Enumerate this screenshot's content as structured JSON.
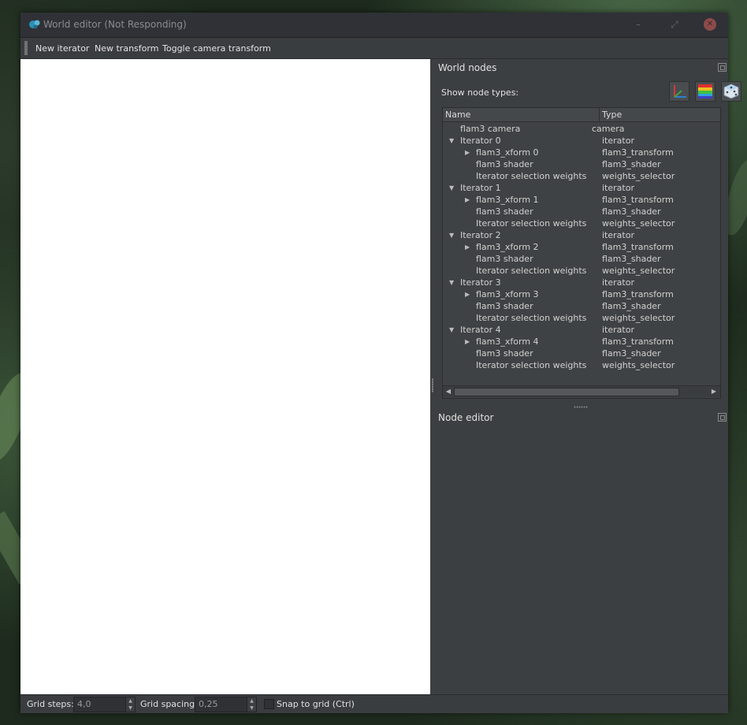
{
  "window": {
    "title": "World editor (Not Responding)",
    "minimize_glyph": "–",
    "maximize_glyph": "⤢",
    "close_glyph": "✕"
  },
  "menubar": {
    "items": [
      "New iterator",
      "New transform",
      "Toggle camera transform"
    ]
  },
  "world_nodes": {
    "title": "World nodes",
    "show_node_types_label": "Show node types:",
    "type_buttons": [
      "axes-icon",
      "color-gradient-icon",
      "dice-icon"
    ],
    "columns": [
      "Name",
      "Type"
    ],
    "rows": [
      {
        "name": "flam3 camera",
        "type": "camera",
        "level": 0,
        "expander": ""
      },
      {
        "name": "Iterator 0",
        "type": "iterator",
        "level": 0,
        "expander": "▼"
      },
      {
        "name": "flam3_xform 0",
        "type": "flam3_transform",
        "level": 1,
        "expander": "▶"
      },
      {
        "name": "flam3 shader",
        "type": "flam3_shader",
        "level": 1,
        "expander": ""
      },
      {
        "name": "Iterator selection weights",
        "type": "weights_selector",
        "level": 1,
        "expander": ""
      },
      {
        "name": "Iterator 1",
        "type": "iterator",
        "level": 0,
        "expander": "▼"
      },
      {
        "name": "flam3_xform 1",
        "type": "flam3_transform",
        "level": 1,
        "expander": "▶"
      },
      {
        "name": "flam3 shader",
        "type": "flam3_shader",
        "level": 1,
        "expander": ""
      },
      {
        "name": "Iterator selection weights",
        "type": "weights_selector",
        "level": 1,
        "expander": ""
      },
      {
        "name": "Iterator 2",
        "type": "iterator",
        "level": 0,
        "expander": "▼"
      },
      {
        "name": "flam3_xform 2",
        "type": "flam3_transform",
        "level": 1,
        "expander": "▶"
      },
      {
        "name": "flam3 shader",
        "type": "flam3_shader",
        "level": 1,
        "expander": ""
      },
      {
        "name": "Iterator selection weights",
        "type": "weights_selector",
        "level": 1,
        "expander": ""
      },
      {
        "name": "Iterator 3",
        "type": "iterator",
        "level": 0,
        "expander": "▼"
      },
      {
        "name": "flam3_xform 3",
        "type": "flam3_transform",
        "level": 1,
        "expander": "▶"
      },
      {
        "name": "flam3 shader",
        "type": "flam3_shader",
        "level": 1,
        "expander": ""
      },
      {
        "name": "Iterator selection weights",
        "type": "weights_selector",
        "level": 1,
        "expander": ""
      },
      {
        "name": "Iterator 4",
        "type": "iterator",
        "level": 0,
        "expander": "▼"
      },
      {
        "name": "flam3_xform 4",
        "type": "flam3_transform",
        "level": 1,
        "expander": "▶"
      },
      {
        "name": "flam3 shader",
        "type": "flam3_shader",
        "level": 1,
        "expander": ""
      },
      {
        "name": "Iterator selection weights",
        "type": "weights_selector",
        "level": 1,
        "expander": ""
      }
    ],
    "scroll_left": "◀",
    "scroll_right": "▶"
  },
  "node_editor": {
    "title": "Node editor"
  },
  "statusbar": {
    "grid_steps_label": "Grid steps:",
    "grid_steps_value": "4,0",
    "grid_spacing_label": "Grid spacing:",
    "grid_spacing_value": "0,25",
    "snap_label": "Snap to grid (Ctrl)",
    "snap_checked": false
  }
}
